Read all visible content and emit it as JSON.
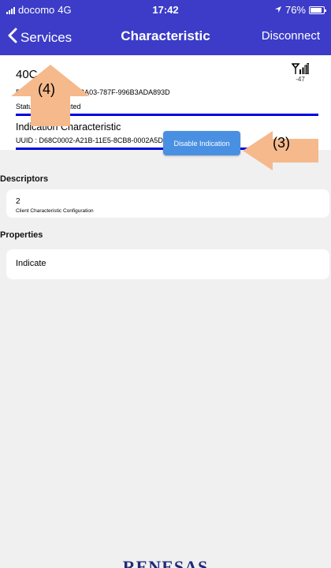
{
  "status_bar": {
    "carrier": "docomo",
    "network": "4G",
    "time": "17:42",
    "battery": "76%",
    "battery_level": 0.76
  },
  "nav": {
    "back_label": "Services",
    "title": "Characteristic",
    "right_label": "Disconnect"
  },
  "device": {
    "name_visible": "40C",
    "uuid_line": "D : 203A7502-44E9-3A03-787F-996B3ADA893D",
    "status_label": "Status :",
    "status_value": "Connected",
    "rssi": "-47"
  },
  "characteristic": {
    "title": "Indication Characteristic",
    "uuid_line": "UUID : D68C0002-A21B-11E5-8CB8-0002A5D5C51B",
    "button_label": "Disable Indication"
  },
  "descriptors": {
    "header": "Descriptors",
    "count": "2",
    "name": "Client Characteristic Configuration"
  },
  "properties": {
    "header": "Properties",
    "value": "Indicate"
  },
  "annotations": {
    "label_4": "(4)",
    "label_3": "(3)",
    "arrow_color": "#f5b98c"
  },
  "colors": {
    "nav_bar": "#3c3cc8",
    "accent_line": "#0000e0",
    "button": "#4a90e2",
    "background": "#f0f0f0"
  },
  "footer": {
    "logo": "RENESAS"
  }
}
